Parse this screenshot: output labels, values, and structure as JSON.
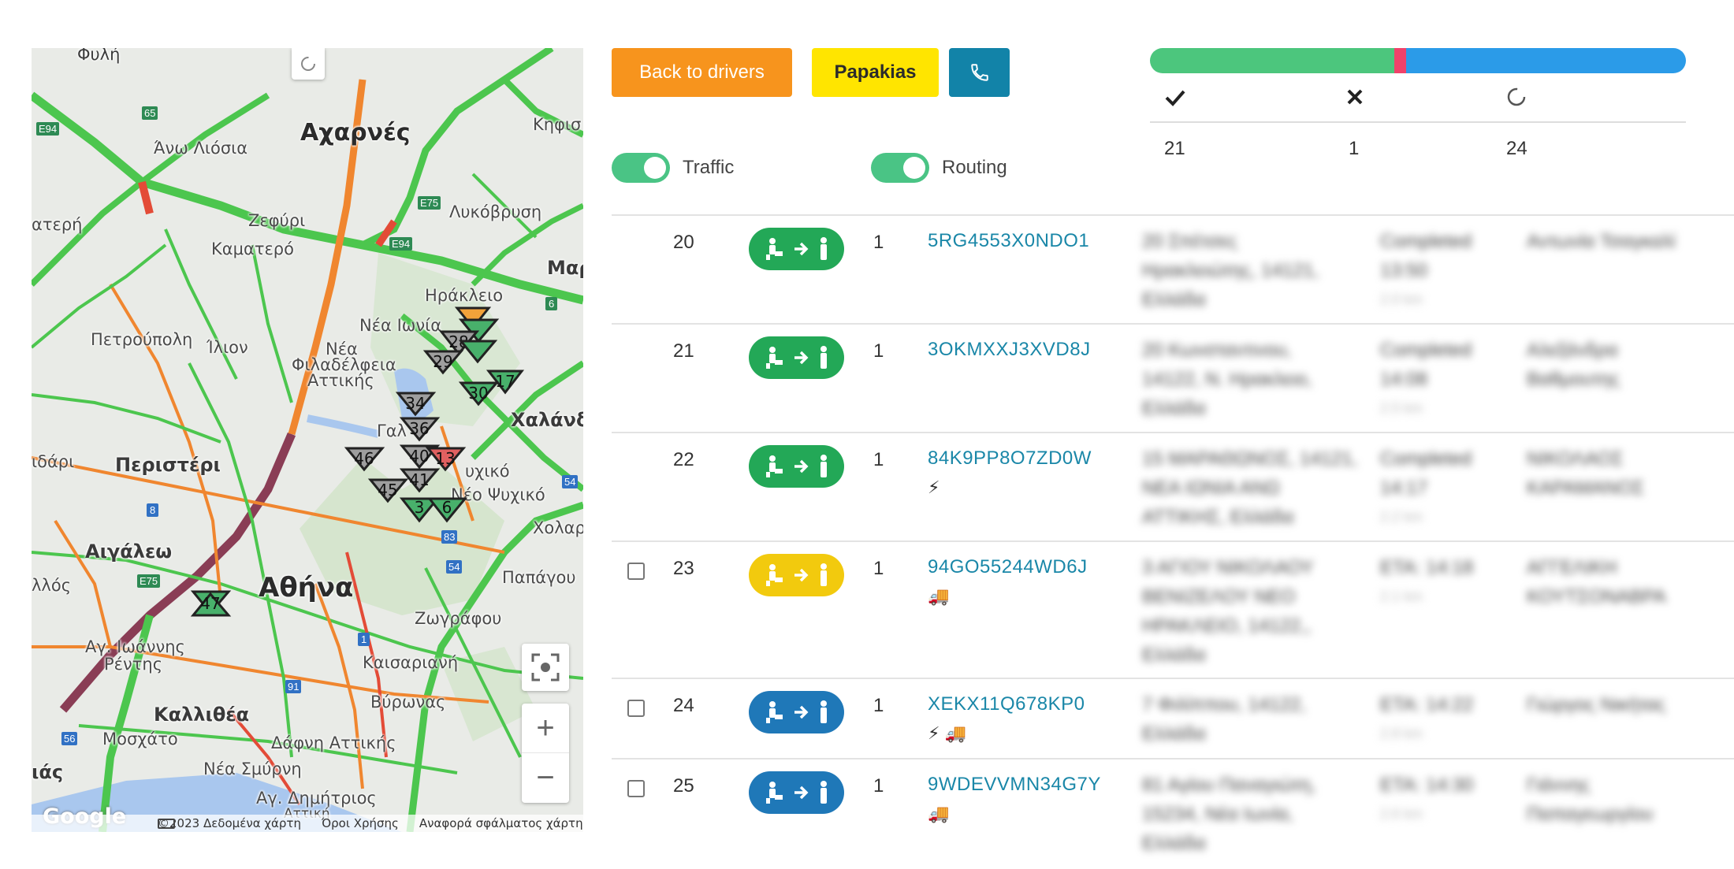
{
  "map": {
    "labels": [
      {
        "text": "Φυλή",
        "cls": "sm"
      },
      {
        "text": "Αχαρνές",
        "cls": "big"
      },
      {
        "text": "Άνω Λιόσια",
        "cls": "sm"
      },
      {
        "text": "Κηφισ",
        "cls": "sm"
      },
      {
        "text": "Ζεφύρι",
        "cls": "sm"
      },
      {
        "text": "Λυκόβρυση",
        "cls": "sm"
      },
      {
        "text": "ατερή",
        "cls": "sm"
      },
      {
        "text": "Καματερό",
        "cls": "sm"
      },
      {
        "text": "Μαρ",
        "cls": "mid"
      },
      {
        "text": "Ηράκλειο",
        "cls": "sm"
      },
      {
        "text": "Πετρούπολη",
        "cls": "sm"
      },
      {
        "text": "Ίλιον",
        "cls": "sm"
      },
      {
        "text": "Νέα Ιωνία",
        "cls": "sm"
      },
      {
        "text": "Νέα",
        "cls": "sm"
      },
      {
        "text": "Φιλαδέλφεια",
        "cls": "sm"
      },
      {
        "text": "Αττικής",
        "cls": "sm"
      },
      {
        "text": "Χαλάνδ",
        "cls": "mid"
      },
      {
        "text": "ιδάρι",
        "cls": "sm"
      },
      {
        "text": "Περιστέρι",
        "cls": "mid"
      },
      {
        "text": "Γαλ",
        "cls": "sm"
      },
      {
        "text": "υχικό",
        "cls": "sm"
      },
      {
        "text": "Νέο Ψυχικό",
        "cls": "sm"
      },
      {
        "text": "Χολαρ",
        "cls": "sm"
      },
      {
        "text": "Αιγάλεω",
        "cls": "mid"
      },
      {
        "text": "Παπάγου",
        "cls": "sm"
      },
      {
        "text": "λλός",
        "cls": "sm"
      },
      {
        "text": "Αθήνα",
        "cls": "big"
      },
      {
        "text": "Ζωγράφου",
        "cls": "sm"
      },
      {
        "text": "Αγ. Ιωάννης",
        "cls": "sm"
      },
      {
        "text": "Ρέντης",
        "cls": "sm"
      },
      {
        "text": "Καισαριανή",
        "cls": "sm"
      },
      {
        "text": "Βύρωνας",
        "cls": "sm"
      },
      {
        "text": "Καλλιθέα",
        "cls": "mid"
      },
      {
        "text": "Μοσχάτο",
        "cls": "sm"
      },
      {
        "text": "Δάφνη Αττικής",
        "cls": "sm"
      },
      {
        "text": "Νέα Σμύρνη",
        "cls": "sm"
      },
      {
        "text": "ιάς",
        "cls": "mid"
      },
      {
        "text": "Αγ. Δημήτριος",
        "cls": "sm"
      },
      {
        "text": "Αττική",
        "cls": "sm"
      }
    ],
    "road_badges": [
      "E94",
      "65",
      "E75",
      "E94",
      "6",
      "54",
      "8",
      "83",
      "54",
      "E75",
      "1",
      "91",
      "56"
    ],
    "markers": [
      "17",
      "28",
      "29",
      "30",
      "34",
      "36",
      "46",
      "40",
      "13",
      "41",
      "45",
      "3",
      "6",
      "47"
    ],
    "google_logo": "Google",
    "footer": {
      "copyright": "©2023 Δεδομένα χάρτη",
      "terms": "Όροι Χρήσης",
      "report": "Αναφορά σφάλματος χάρτη"
    },
    "controls": {
      "zoom_in": "+",
      "zoom_out": "−"
    }
  },
  "toolbar": {
    "back_label": "Back to drivers",
    "driver_label": "Papakias",
    "phone_icon": "phone-icon"
  },
  "toggles": {
    "traffic_label": "Traffic",
    "routing_label": "Routing"
  },
  "status": {
    "progress": {
      "completed": 21,
      "failed": 1,
      "pending": 24
    },
    "colors": {
      "completed": "#4cc67d",
      "failed": "#f0426a",
      "pending": "#2b9be8"
    },
    "headers": {
      "completed_icon": "check-icon",
      "failed_icon": "x-icon",
      "pending_icon": "spinner-icon"
    },
    "values": {
      "completed": "21",
      "failed": "1",
      "pending": "24"
    }
  },
  "rows": [
    {
      "num": "20",
      "status": "green",
      "qty": "1",
      "code": "5RG4553X0NDO1",
      "tags": "",
      "checkbox": false,
      "address": [
        "20 Σπέτσες",
        "Ηρακλειώτης, 14121,",
        "Ελλάδα"
      ],
      "state": [
        "Completed",
        "13:50"
      ],
      "state_sub": "2.0 km",
      "person": [
        "Αντωνία Τσαγκαλί"
      ]
    },
    {
      "num": "21",
      "status": "green",
      "qty": "1",
      "code": "3OKMXXJ3XVD8J",
      "tags": "",
      "checkbox": false,
      "address": [
        "20 Κωνσταντινου,",
        "14122, Ν. Ηρακλειο,",
        "Ελλάδα"
      ],
      "state": [
        "Completed",
        "14:08"
      ],
      "state_sub": "2.5 km",
      "person": [
        "Αλεξάνδρα",
        "Βαθμουτης"
      ]
    },
    {
      "num": "22",
      "status": "green",
      "qty": "1",
      "code": "84K9PP8O7ZD0W",
      "tags": "⚡",
      "checkbox": false,
      "address": [
        "15 ΜΑΡΑΘΩΝΟΣ, 14121,",
        "ΝΕΑ ΙΩΝΙΑ ΑΝΩ",
        "ΑΤΤΙΚΗΣ, Ελλάδα"
      ],
      "state": [
        "Completed",
        "14:17"
      ],
      "state_sub": "2.2 km",
      "person": [
        "ΝΙΚΟΛΑΟΣ",
        "ΚΑΡΑΜΑΝΟΣ"
      ]
    },
    {
      "num": "23",
      "status": "yellow",
      "qty": "1",
      "code": "94GO55244WD6J",
      "tags": "🚚",
      "checkbox": true,
      "address": [
        "3 ΑΓΙΟΥ ΝΙΚΟΛΑΟΥ",
        "ΒΕΝΙΖΕΛΟΥ ΝΕΟ",
        "ΗΡΑΚΛΕΙΟ, 14122,,",
        "Ελλάδα"
      ],
      "state": [
        "ETA: 14:18"
      ],
      "state_sub": "2.1 km",
      "person": [
        "ΑΓΓΕΛΙΚΗ",
        "ΚΟΥΤΣΟΝΑΒΡΑ"
      ]
    },
    {
      "num": "24",
      "status": "blue",
      "qty": "1",
      "code": "XEKX11Q678KP0",
      "tags": "⚡ 🚚",
      "checkbox": true,
      "address": [
        "7 Φιλίππου, 14122,",
        "Ελλάδα"
      ],
      "state": [
        "ETA: 14:22"
      ],
      "state_sub": "2.8 km",
      "person": [
        "Γιώργος Νικήτας"
      ]
    },
    {
      "num": "25",
      "status": "blue",
      "qty": "1",
      "code": "9WDEVVMN34G7Y",
      "tags": "🚚",
      "checkbox": true,
      "address": [
        "81 Αγίου Παναγιώτη,",
        "15234, Νέα Ιωνία,",
        "Ελλάδα"
      ],
      "state": [
        "ETA: 14:30"
      ],
      "state_sub": "2.6 km",
      "person": [
        "Γιάννης",
        "Παπαγεωργίου"
      ]
    }
  ]
}
